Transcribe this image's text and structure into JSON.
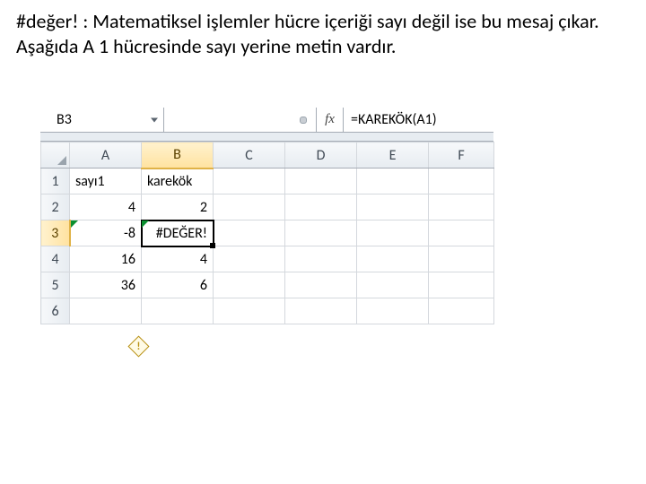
{
  "caption": "#değer! : Matematiksel işlemler hücre içeriği sayı değil ise bu mesaj çıkar. Aşağıda  A 1 hücresinde sayı yerine metin vardır.",
  "nameBox": "B3",
  "fxLabel": "fx",
  "formula": "=KAREKÖK(A1)",
  "columns": [
    "A",
    "B",
    "C",
    "D",
    "E",
    "F"
  ],
  "activeCol": "B",
  "rows": [
    "1",
    "2",
    "3",
    "4",
    "5",
    "6"
  ],
  "activeRow": "3",
  "cells": {
    "r1": {
      "A": {
        "v": "sayı1",
        "t": "txt"
      },
      "B": {
        "v": "karekök",
        "t": "txt"
      }
    },
    "r2": {
      "A": {
        "v": "4",
        "t": "num"
      },
      "B": {
        "v": "2",
        "t": "num"
      }
    },
    "r3": {
      "A": {
        "v": "-8",
        "t": "num"
      },
      "B": {
        "v": "#DEĞER!",
        "t": "err"
      }
    },
    "r4": {
      "A": {
        "v": "16",
        "t": "num"
      },
      "B": {
        "v": "4",
        "t": "num"
      }
    },
    "r5": {
      "A": {
        "v": "36",
        "t": "num"
      },
      "B": {
        "v": "6",
        "t": "num"
      }
    },
    "r6": {}
  },
  "selectedCell": "B3",
  "errorCells": [
    "A3",
    "B3"
  ],
  "errorSmartTagAt": "A3"
}
